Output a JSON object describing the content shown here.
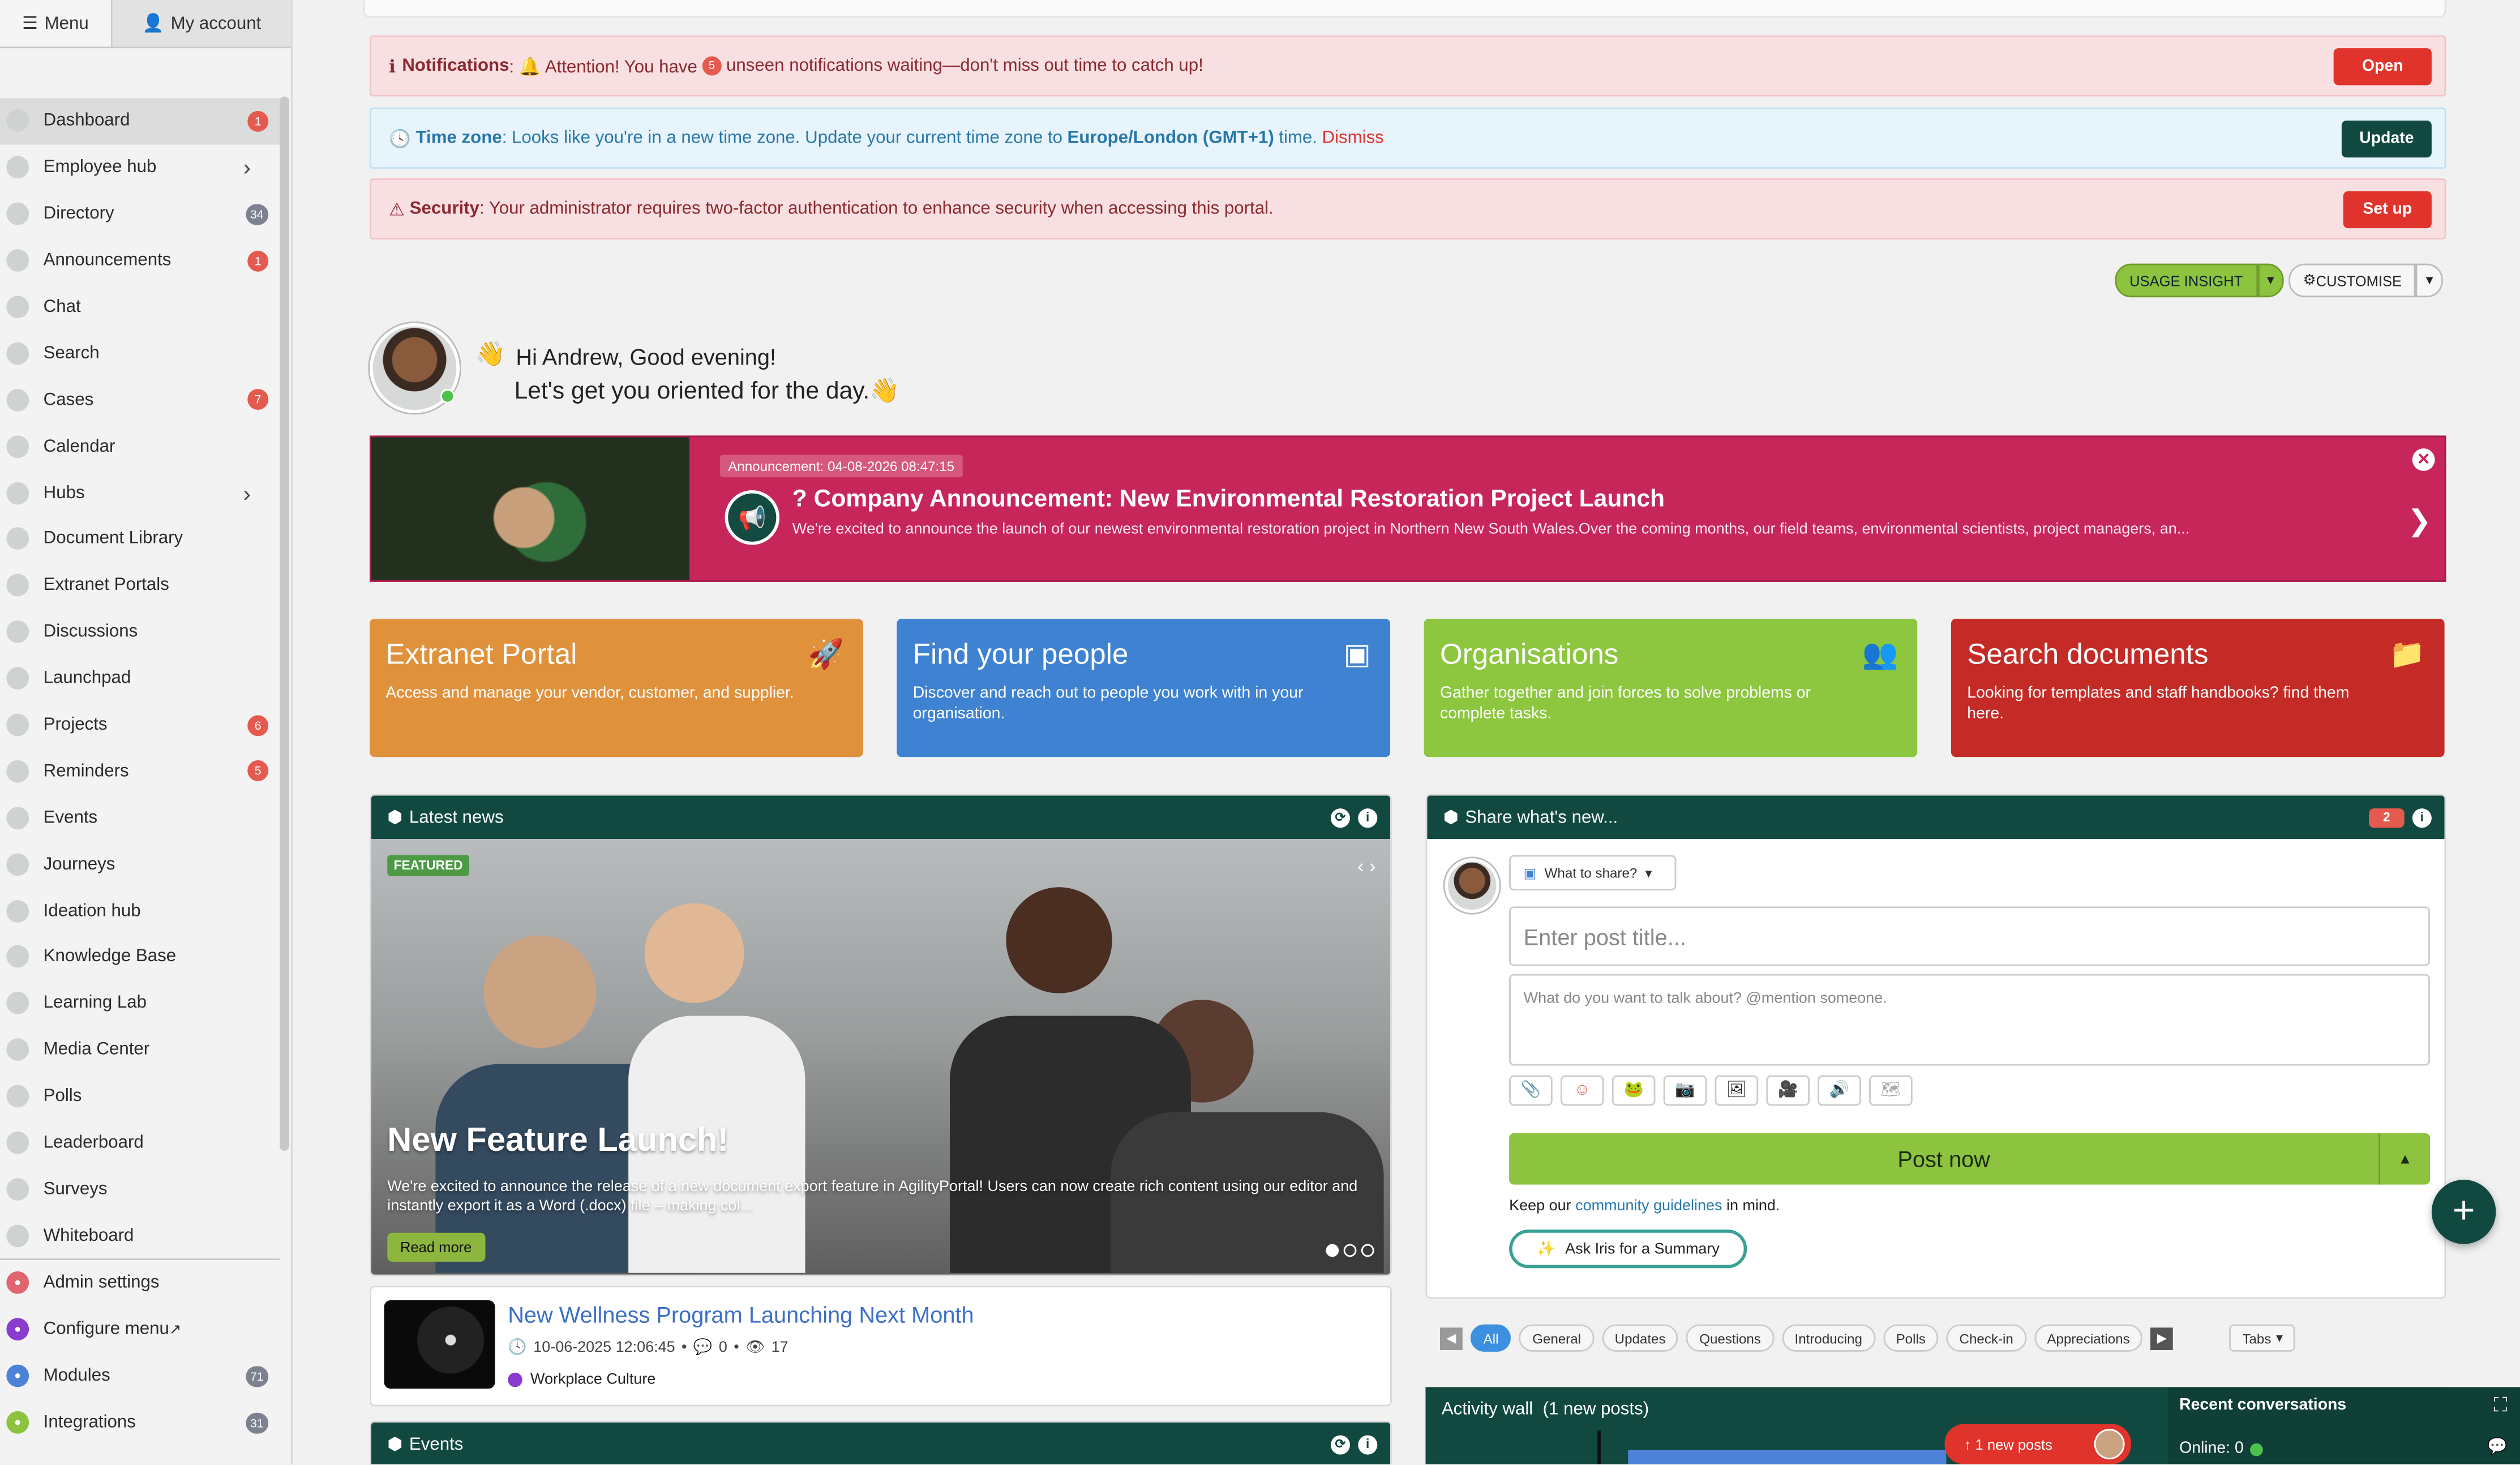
{
  "sidebar": {
    "menu_tab": "Menu",
    "account_tab": "My account",
    "items": [
      {
        "label": "Dashboard",
        "badge": "1"
      },
      {
        "label": "Employee hub",
        "badge": ""
      },
      {
        "label": "Directory",
        "badge": "34"
      },
      {
        "label": "Announcements",
        "badge": "1"
      },
      {
        "label": "Chat",
        "badge": ""
      },
      {
        "label": "Search",
        "badge": ""
      },
      {
        "label": "Cases",
        "badge": "7"
      },
      {
        "label": "Calendar",
        "badge": ""
      },
      {
        "label": "Hubs",
        "badge": ""
      },
      {
        "label": "Document Library",
        "badge": ""
      },
      {
        "label": "Extranet Portals",
        "badge": ""
      },
      {
        "label": "Discussions",
        "badge": ""
      },
      {
        "label": "Launchpad",
        "badge": ""
      },
      {
        "label": "Projects",
        "badge": "6"
      },
      {
        "label": "Reminders",
        "badge": "5"
      },
      {
        "label": "Events",
        "badge": ""
      },
      {
        "label": "Journeys",
        "badge": ""
      },
      {
        "label": "Ideation hub",
        "badge": ""
      },
      {
        "label": "Knowledge Base",
        "badge": ""
      },
      {
        "label": "Learning Lab",
        "badge": ""
      },
      {
        "label": "Media Center",
        "badge": ""
      },
      {
        "label": "Polls",
        "badge": ""
      },
      {
        "label": "Leaderboard",
        "badge": ""
      },
      {
        "label": "Surveys",
        "badge": ""
      },
      {
        "label": "Whiteboard",
        "badge": ""
      }
    ],
    "admin": [
      {
        "label": "Admin settings",
        "badge": ""
      },
      {
        "label": "Configure menu",
        "badge": ""
      },
      {
        "label": "Modules",
        "badge": "71"
      },
      {
        "label": "Integrations",
        "badge": "31"
      }
    ]
  },
  "alerts": {
    "notif": {
      "title": "Notifications",
      "pre": ": 🔔 Attention! You have",
      "count": "5",
      "post": "unseen notifications waiting—don't miss out time to catch up!",
      "button": "Open"
    },
    "tz": {
      "title": "Time zone",
      "pre": ": Looks like you're in a new time zone. Update your current time zone to",
      "zone": "Europe/London (GMT+1)",
      "post": "time.",
      "dismiss": "Dismiss",
      "button": "Update"
    },
    "sec": {
      "title": "Security",
      "text": ": Your administrator requires two-factor authentication to enhance security when accessing this portal.",
      "button": "Set up"
    }
  },
  "controls": {
    "usage": "USAGE INSIGHT",
    "customise": "CUSTOMISE"
  },
  "greeting": {
    "line1": "Hi Andrew, Good evening!",
    "line2": "Let's get you oriented for the day.👋"
  },
  "announcement": {
    "tag": "Announcement: 04-08-2026 08:47:15",
    "title": "? Company Announcement: New Environmental Restoration Project Launch",
    "desc": "We're excited to announce the launch of our newest environmental restoration project in Northern New South Wales.Over the coming months, our field teams, environmental scientists, project managers, an..."
  },
  "tiles": [
    {
      "title": "Extranet Portal",
      "desc": "Access and manage your vendor, customer, and supplier.",
      "color": "#e0913b"
    },
    {
      "title": "Find your people",
      "desc": "Discover and reach out to people you work with in your organisation.",
      "color": "#3e82d1"
    },
    {
      "title": "Organisations",
      "desc": "Gather together and join forces to solve problems or complete tasks.",
      "color": "#8dc63f"
    },
    {
      "title": "Search documents",
      "desc": "Looking for templates and staff handbooks? find them here.",
      "color": "#c42b27"
    }
  ],
  "news": {
    "header": "Latest news",
    "featured": "FEATURED",
    "title": "New Feature Launch!",
    "desc": "We're excited to announce the release of a new document export feature in AgilityPortal! Users can now create rich content using our editor and instantly export it as a Word (.docx) file – making col...",
    "read_more": "Read more",
    "item": {
      "title": "New Wellness Program Launching Next Month",
      "date": "10-06-2025 12:06:45",
      "comments": "0",
      "views": "17",
      "category": "Workplace Culture"
    }
  },
  "events": {
    "header": "Events"
  },
  "share": {
    "header": "Share what's new...",
    "count": "2",
    "what": "What to share?",
    "title_ph": "Enter post title...",
    "body_ph": "What do you want to talk about? @mention someone.",
    "post": "Post now",
    "keep_pre": "Keep our",
    "guidelines": "community guidelines",
    "keep_post": "in mind.",
    "iris": "Ask Iris for a Summary"
  },
  "filters": [
    "All",
    "General",
    "Updates",
    "Questions",
    "Introducing",
    "Polls",
    "Check-in",
    "Appreciations"
  ],
  "tabs_label": "Tabs",
  "wall": {
    "title": "Activity wall",
    "new": "(1 new posts)",
    "new_btn": "1 new posts"
  },
  "recent": {
    "title": "Recent conversations",
    "online": "Online: 0"
  }
}
